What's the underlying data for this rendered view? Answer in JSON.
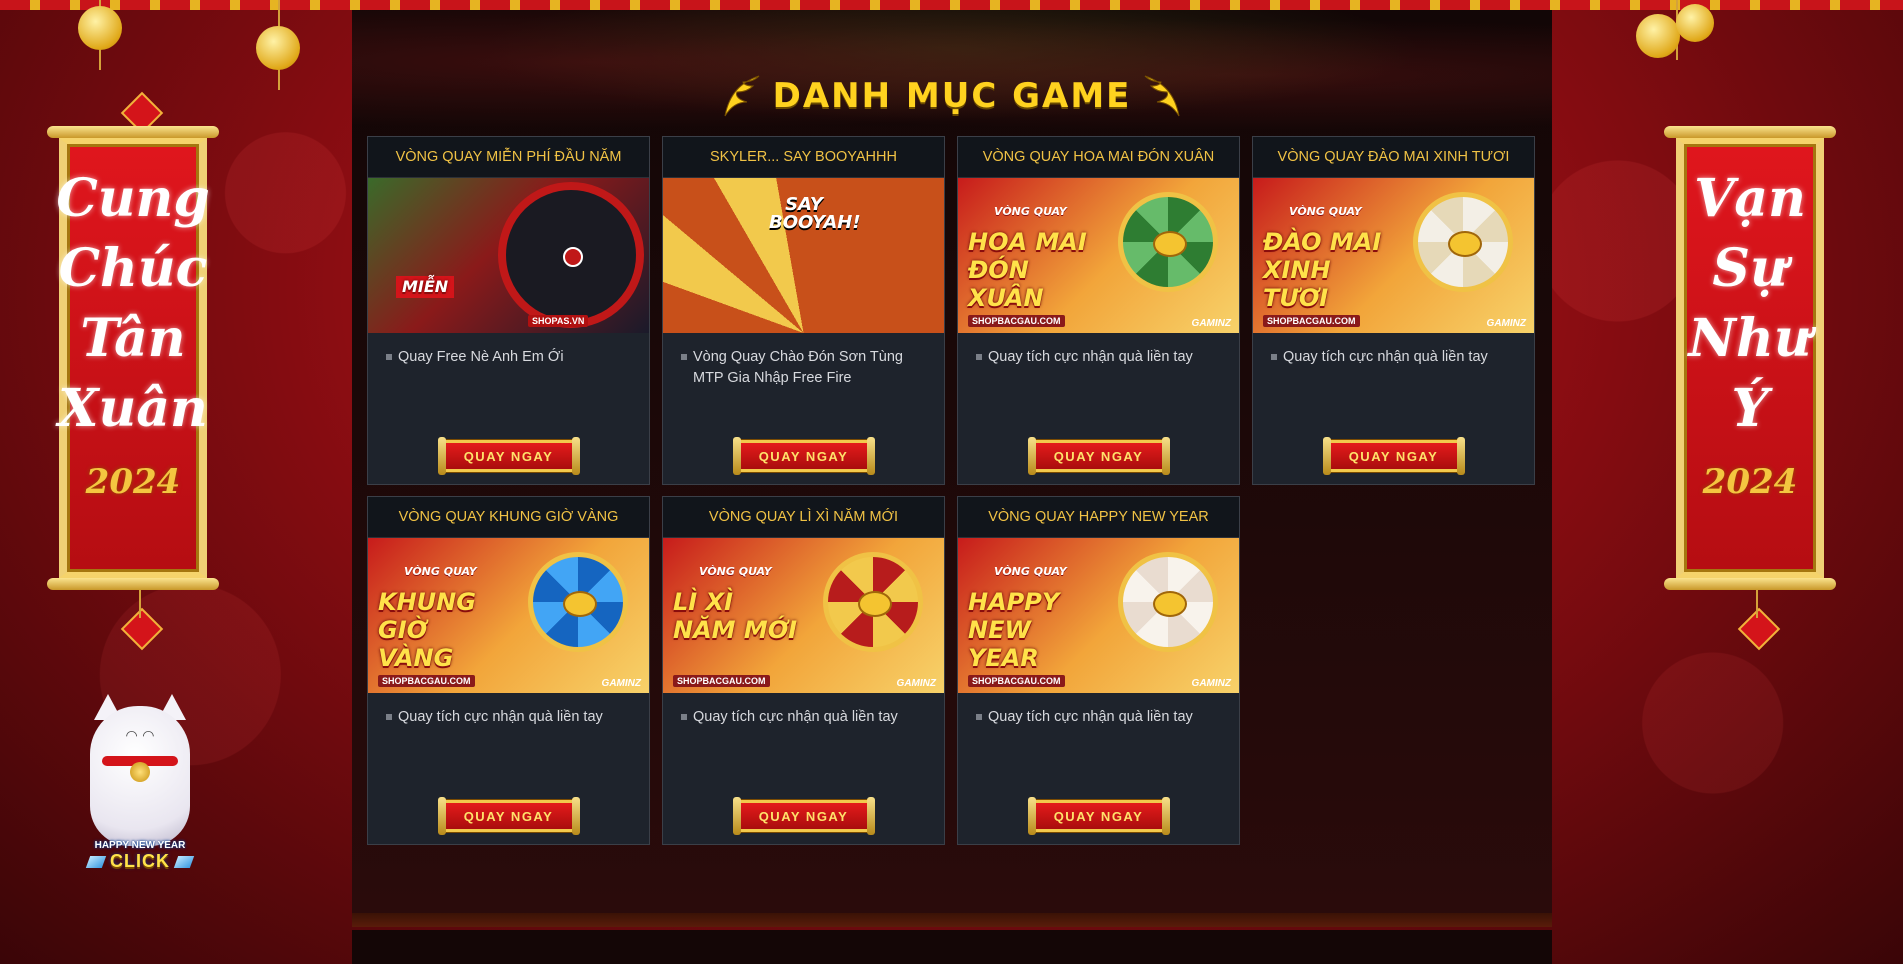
{
  "banners": {
    "left": {
      "lines": [
        "Cung",
        "Chúc",
        "Tân",
        "Xuân"
      ],
      "year": "2024"
    },
    "right": {
      "lines": [
        "Vạn",
        "Sự",
        "Như",
        "Ý"
      ],
      "year": "2024"
    }
  },
  "mascot": {
    "caption_small": "HAPPY NEW YEAR",
    "caption_big": "CLICK"
  },
  "section": {
    "title": "DANH MỤC GAME"
  },
  "cards": [
    {
      "title": "VÒNG QUAY MIỄN PHÍ ĐẦU NĂM",
      "description": "Quay Free Nè Anh Em Ới",
      "button": "QUAY NGAY",
      "art": {
        "top": "",
        "main": "MIỄN",
        "domain": "SHOPAS.VN",
        "brand": ""
      }
    },
    {
      "title": "SKYLER... SAY BOOYAHHH",
      "description": "Vòng Quay Chào Đón Sơn Tùng MTP Gia Nhập Free Fire",
      "button": "QUAY NGAY",
      "art": {
        "top": "SAY BOOYAH!",
        "main": "",
        "domain": "",
        "brand": ""
      }
    },
    {
      "title": "VÒNG QUAY HOA MAI ĐÓN XUÂN",
      "description": "Quay tích cực nhận quà liền tay",
      "button": "QUAY NGAY",
      "art": {
        "top": "VÒNG QUAY",
        "main": "HOA MAI ĐÓN XUÂN",
        "domain": "SHOPBACGAU.COM",
        "brand": "GAMINZ"
      }
    },
    {
      "title": "VÒNG QUAY ĐÀO MAI XINH TƯƠI",
      "description": "Quay tích cực nhận quà liền tay",
      "button": "QUAY NGAY",
      "art": {
        "top": "VÒNG QUAY",
        "main": "ĐÀO MAI XINH TƯƠI",
        "domain": "SHOPBACGAU.COM",
        "brand": "GAMINZ"
      }
    },
    {
      "title": "VÒNG QUAY KHUNG GIỜ VÀNG",
      "description": "Quay tích cực nhận quà liền tay",
      "button": "QUAY NGAY",
      "art": {
        "top": "VÒNG QUAY",
        "main": "KHUNG GIỜ VÀNG",
        "domain": "SHOPBACGAU.COM",
        "brand": "GAMINZ"
      }
    },
    {
      "title": "VÒNG QUAY LÌ XÌ NĂM MỚI",
      "description": "Quay tích cực nhận quà liền tay",
      "button": "QUAY NGAY",
      "art": {
        "top": "VÒNG QUAY",
        "main": "LÌ XÌ NĂM MỚI",
        "domain": "SHOPBACGAU.COM",
        "brand": "GAMINZ"
      }
    },
    {
      "title": "VÒNG QUAY HAPPY NEW YEAR",
      "description": "Quay tích cực nhận quà liền tay",
      "button": "QUAY NGAY",
      "art": {
        "top": "VÒNG QUAY",
        "main": "HAPPY NEW YEAR",
        "domain": "SHOPBACGAU.COM",
        "brand": "GAMINZ"
      }
    }
  ],
  "colors": {
    "accent": "#ffd21f",
    "card_bg": "#1e232c",
    "button": "#d41414"
  }
}
